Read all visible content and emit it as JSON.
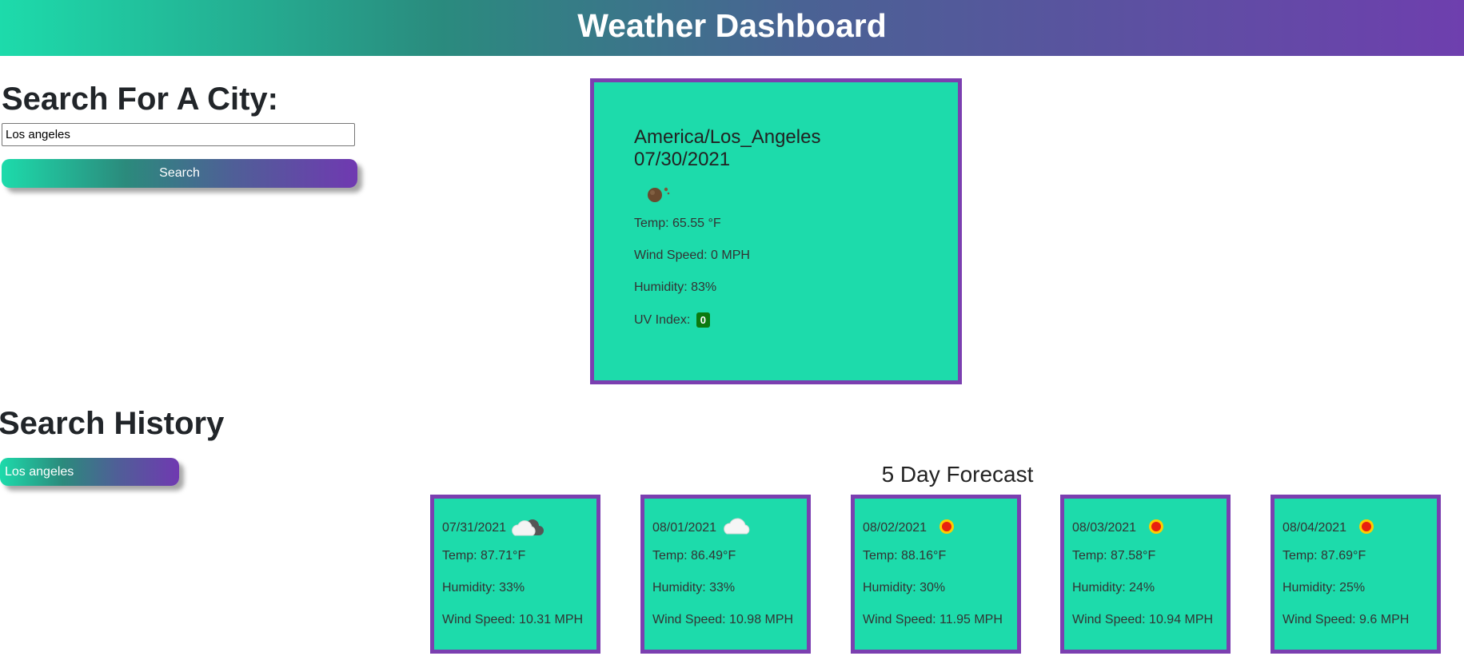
{
  "header": {
    "title": "Weather Dashboard"
  },
  "search": {
    "title": "Search For A City:",
    "input_value": "Los angeles",
    "button_label": "Search"
  },
  "history": {
    "title": "Search History",
    "items": [
      "Los angeles"
    ]
  },
  "current": {
    "location": "America/Los_Angeles",
    "date": "07/30/2021",
    "icon": "night-sky-icon",
    "temp": "Temp: 65.55 °F",
    "wind": "Wind Speed: 0 MPH",
    "humidity": "Humidity: 83%",
    "uv_label": "UV Index:",
    "uv_value": "0",
    "uv_color": "#0b7a10"
  },
  "forecast": {
    "title": "5 Day Forecast",
    "days": [
      {
        "date": "07/31/2021",
        "icon": "partly-cloudy-icon",
        "temp": "Temp: 87.71°F",
        "humidity": "Humidity: 33%",
        "wind": "Wind Speed: 10.31 MPH"
      },
      {
        "date": "08/01/2021",
        "icon": "cloud-icon",
        "temp": "Temp: 86.49°F",
        "humidity": "Humidity: 33%",
        "wind": "Wind Speed: 10.98 MPH"
      },
      {
        "date": "08/02/2021",
        "icon": "sun-icon",
        "temp": "Temp: 88.16°F",
        "humidity": "Humidity: 30%",
        "wind": "Wind Speed: 11.95 MPH"
      },
      {
        "date": "08/03/2021",
        "icon": "sun-icon",
        "temp": "Temp: 87.58°F",
        "humidity": "Humidity: 24%",
        "wind": "Wind Speed: 10.94 MPH"
      },
      {
        "date": "08/04/2021",
        "icon": "sun-icon",
        "temp": "Temp: 87.69°F",
        "humidity": "Humidity: 25%",
        "wind": "Wind Speed: 9.6 MPH"
      }
    ]
  },
  "colors": {
    "card_bg": "#1ddbab",
    "card_border": "#7b3fb0",
    "gradient_start": "#1ddbab",
    "gradient_end": "#7039b1"
  }
}
